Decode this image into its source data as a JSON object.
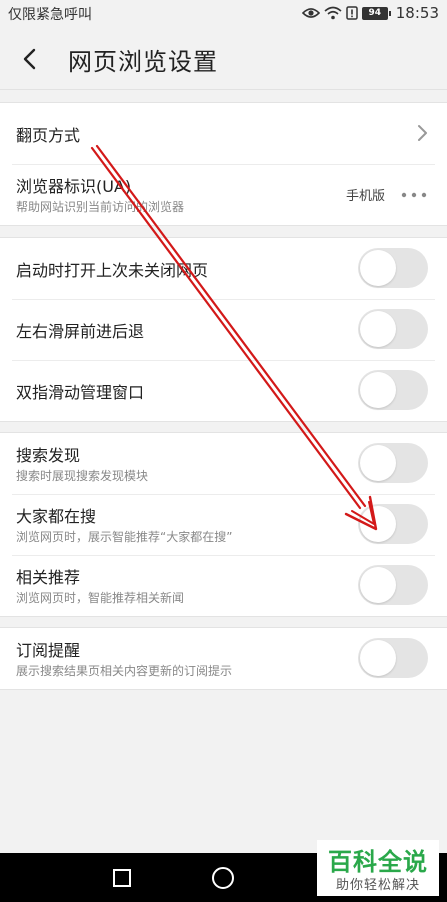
{
  "status_bar": {
    "carrier": "仅限紧急呼叫",
    "battery": "94",
    "time": "18:53"
  },
  "header": {
    "title": "网页浏览设置"
  },
  "groups": [
    {
      "rows": [
        {
          "title": "翻页方式",
          "control": "chevron"
        },
        {
          "title": "浏览器标识(UA)",
          "subtitle": "帮助网站识别当前访问的浏览器",
          "value": "手机版",
          "control": "more"
        }
      ]
    },
    {
      "rows": [
        {
          "title": "启动时打开上次未关闭网页",
          "control": "toggle",
          "on": false
        },
        {
          "title": "左右滑屏前进后退",
          "control": "toggle",
          "on": false
        },
        {
          "title": "双指滑动管理窗口",
          "control": "toggle",
          "on": false
        }
      ]
    },
    {
      "rows": [
        {
          "title": "搜索发现",
          "subtitle": "搜索时展现搜索发现模块",
          "control": "toggle",
          "on": false
        },
        {
          "title": "大家都在搜",
          "subtitle": "浏览网页时，展示智能推荐“大家都在搜”",
          "control": "toggle",
          "on": false
        },
        {
          "title": "相关推荐",
          "subtitle": "浏览网页时，智能推荐相关新闻",
          "control": "toggle",
          "on": false
        }
      ]
    },
    {
      "rows": [
        {
          "title": "订阅提醒",
          "subtitle": "展示搜索结果页相关内容更新的订阅提示",
          "control": "toggle",
          "on": false
        }
      ]
    }
  ],
  "watermark": {
    "top": "百科全说",
    "bottom": "助你轻松解决"
  },
  "colors": {
    "annotation": "#d31919",
    "toggle_off": "#e4e4e4",
    "watermark_green": "#2aa84a"
  }
}
